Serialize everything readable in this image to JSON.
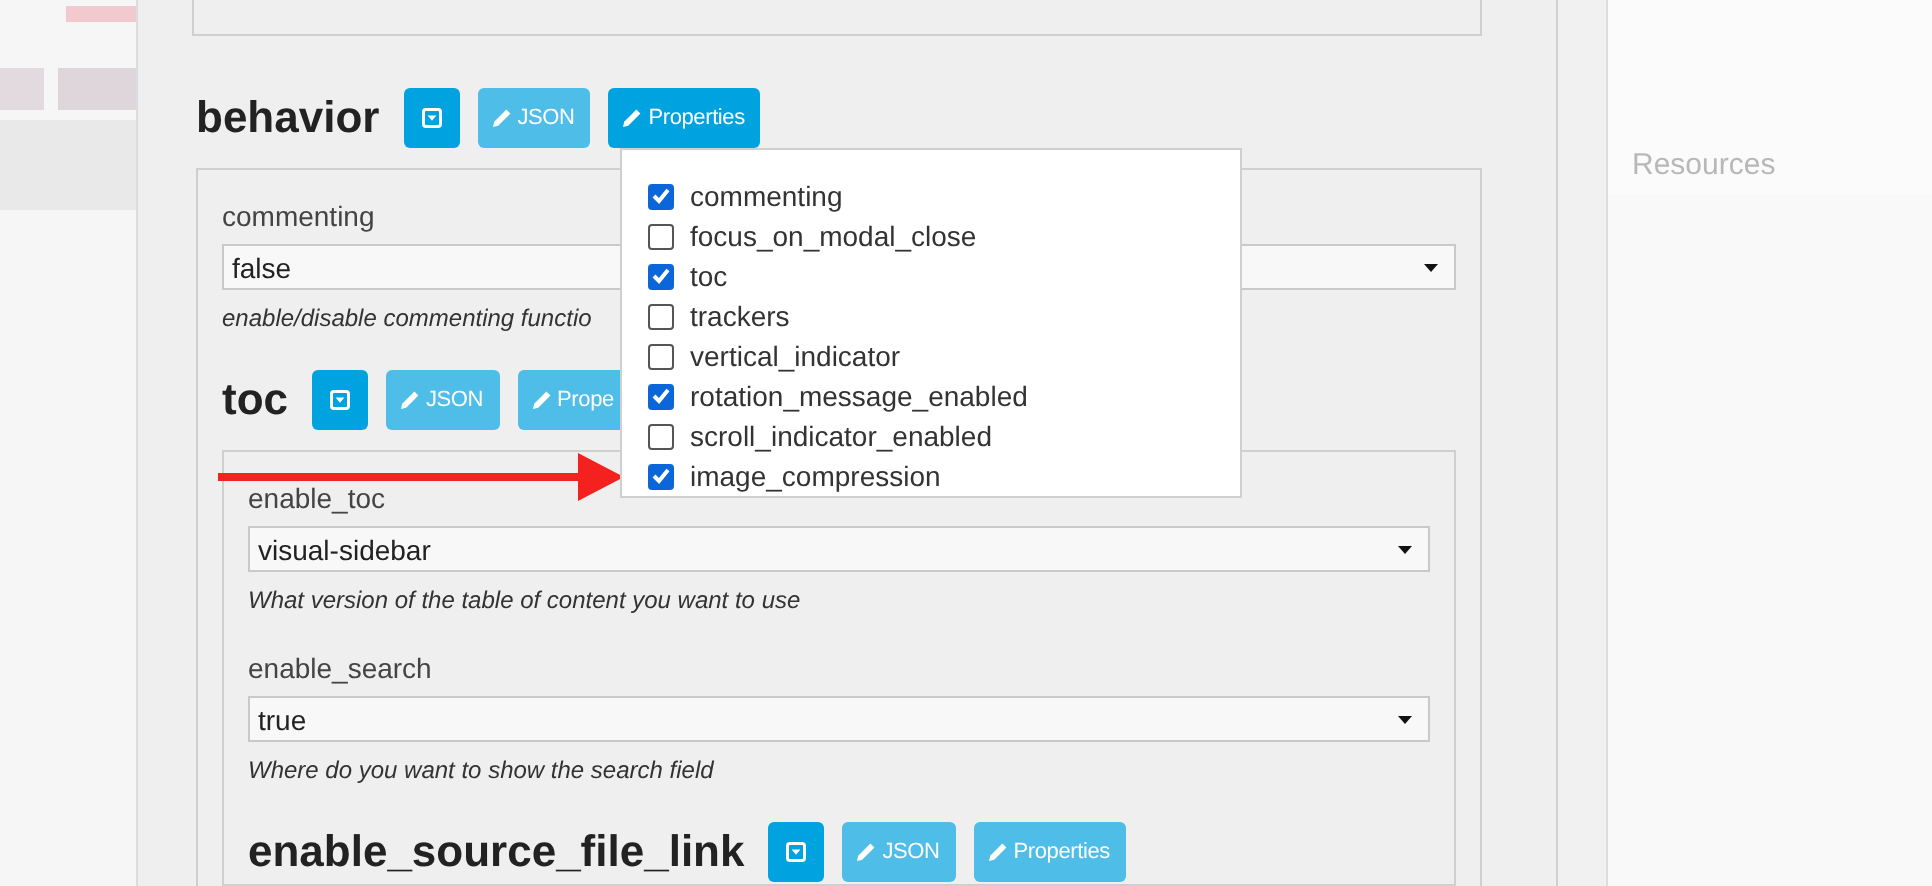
{
  "sections": [
    {
      "title": "behavior",
      "buttons": [
        {
          "kind": "toggle",
          "active": true
        },
        {
          "kind": "json",
          "label": "JSON",
          "active": false
        },
        {
          "kind": "properties",
          "label": "Properties",
          "active": true
        }
      ],
      "fields": [
        {
          "label": "commenting",
          "value": "false",
          "help": "enable/disable commenting functio"
        }
      ],
      "children": [
        {
          "title": "toc",
          "buttons": [
            {
              "kind": "toggle",
              "active": true
            },
            {
              "kind": "json",
              "label": "JSON",
              "active": false
            },
            {
              "kind": "properties",
              "label": "Prope",
              "active": false
            }
          ],
          "fields": [
            {
              "label": "enable_toc",
              "value": "visual-sidebar",
              "help": "What version of the table of content you want to use"
            },
            {
              "label": "enable_search",
              "value": "true",
              "help": "Where do you want to show the search field"
            }
          ],
          "children": [
            {
              "title": "enable_source_file_link",
              "buttons": [
                {
                  "kind": "toggle",
                  "active": true
                },
                {
                  "kind": "json",
                  "label": "JSON",
                  "active": false
                },
                {
                  "kind": "properties",
                  "label": "Properties",
                  "active": false
                }
              ]
            }
          ]
        }
      ]
    }
  ],
  "properties_menu": {
    "items": [
      {
        "label": "commenting",
        "checked": true
      },
      {
        "label": "focus_on_modal_close",
        "checked": false
      },
      {
        "label": "toc",
        "checked": true
      },
      {
        "label": "trackers",
        "checked": false
      },
      {
        "label": "vertical_indicator",
        "checked": false
      },
      {
        "label": "rotation_message_enabled",
        "checked": true
      },
      {
        "label": "scroll_indicator_enabled",
        "checked": false
      },
      {
        "label": "image_compression",
        "checked": true
      }
    ]
  },
  "background": {
    "heading": "Resources"
  }
}
